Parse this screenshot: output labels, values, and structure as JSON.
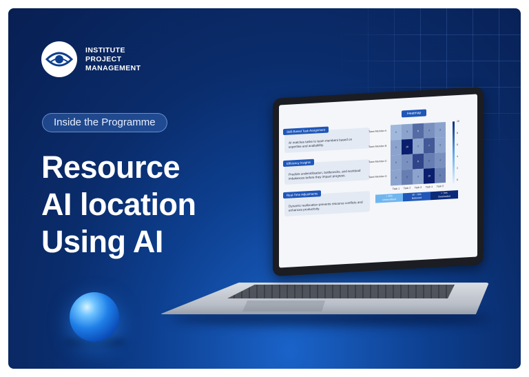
{
  "brand": {
    "line1": "INSTITUTE",
    "line2": "PROJECT",
    "line3": "MANAGEMENT"
  },
  "badge": "Inside the Programme",
  "headline": {
    "line1": "Resource",
    "line2": "AI location",
    "line3": "Using AI"
  },
  "colors": {
    "background": "#0a2c6b",
    "accent": "#1f57b8",
    "text": "#ffffff"
  },
  "screen": {
    "cards": [
      {
        "tag": "Skill-Based Task Assignment",
        "text": "AI matches tasks to team members based on expertise and availability."
      },
      {
        "tag": "Efficiency Insights",
        "text": "Predicts underutilisation, bottlenecks, and workload imbalances before they impact progress."
      },
      {
        "tag": "Real-Time Adjustments",
        "text": "Dynamic reallocation prevents resource conflicts and enhances productivity."
      }
    ],
    "heatmap": {
      "title": "Heatmap",
      "rows": [
        "Team Member A",
        "Team Member B",
        "Team Member C",
        "Team Member D"
      ],
      "cols": [
        "Task 1",
        "Task 2",
        "Task 3",
        "Task 4",
        "Task 5"
      ],
      "values": [
        [
          2,
          3,
          6,
          4,
          3
        ],
        [
          3,
          10,
          3,
          7,
          3
        ],
        [
          3,
          4,
          8,
          5,
          4
        ],
        [
          3,
          5,
          3,
          10,
          5
        ]
      ],
      "scale_ticks": [
        "10",
        "8",
        "6",
        "4",
        "2",
        "0"
      ],
      "legend": [
        {
          "line1": "< 40%",
          "line2": "Underutilised"
        },
        {
          "line1": "40 - 70%",
          "line2": "Balanced"
        },
        {
          "line1": "> 70%",
          "line2": "Overloaded"
        }
      ]
    }
  }
}
